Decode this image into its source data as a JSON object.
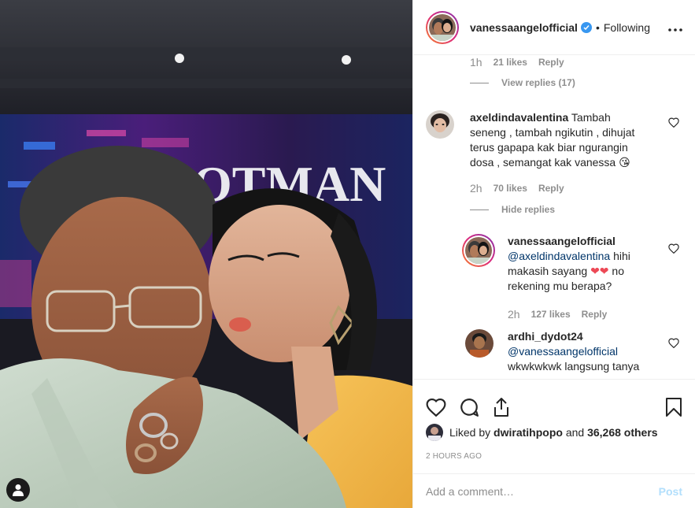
{
  "post": {
    "username": "vanessaangelofficial",
    "dot": "•",
    "follow_status": "Following",
    "more_icon": "more-dots-icon"
  },
  "photo": {
    "sign_text": "OTMAN"
  },
  "thread": {
    "first_meta": {
      "time": "1h",
      "likes": "21 likes",
      "reply": "Reply"
    },
    "first_view_replies": "View replies (17)",
    "comment": {
      "username": "axeldindavalentina",
      "text": "Tambah seneng , tambah ngikutin , dihujat terus gapapa kak biar ngurangin dosa , semangat kak vanessa 😘",
      "line1": "Tambah",
      "line2": "seneng , tambah ngikutin , dihujat",
      "line3": "terus gapapa kak biar ngurangin",
      "line4": "dosa , semangat kak vanessa",
      "emoji": "😘",
      "time": "2h",
      "likes": "70 likes",
      "reply": "Reply",
      "hide_replies": "Hide replies"
    },
    "reply1": {
      "username": "vanessaangelofficial",
      "mention": "@axeldindavalentina",
      "line1_after": " hihi",
      "line2": "makasih sayang",
      "hearts": "❤❤",
      "line2_after": " no",
      "line3": "rekening mu berapa?",
      "time": "2h",
      "likes": "127 likes",
      "reply": "Reply"
    },
    "reply2": {
      "username": "ardhi_dydot24",
      "mention": "@vanessaangelofficial",
      "line3": "wkwkwkwk langsung tanya"
    }
  },
  "footer": {
    "liked_by_prefix": "Liked by ",
    "liked_by_user": "dwiratihpopo",
    "liked_by_mid": " and ",
    "liked_by_count": "36,268 others",
    "timestamp": "2 HOURS AGO",
    "comment_placeholder": "Add a comment…",
    "post_label": "Post"
  },
  "colors": {
    "verified": "#3897f0",
    "secondary_text": "#8e8e8e",
    "mention": "#003569",
    "post_disabled": "#b2dffc",
    "heart_emoji": "#ed4956"
  }
}
